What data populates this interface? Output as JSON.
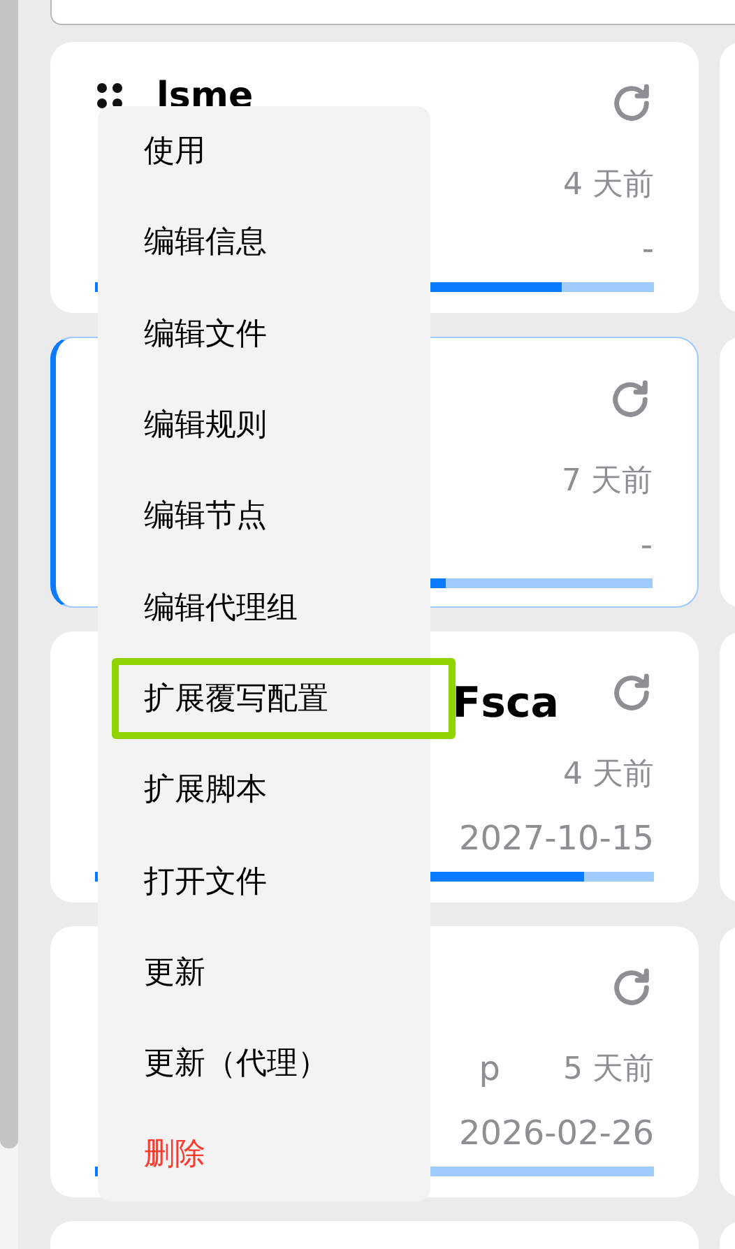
{
  "cards": [
    {
      "title": "lsme",
      "handle": true,
      "selected": false,
      "time": "4 天前",
      "expire": "-",
      "level": 0.835
    },
    {
      "handle": false,
      "selected": true,
      "time": "7 天前",
      "expire": "-",
      "level": 0.625
    },
    {
      "title": "Fsca",
      "handle": false,
      "selected": false,
      "time": "4 天前",
      "expire": "2027-10-15",
      "level": 0.875
    },
    {
      "handle": false,
      "selected": false,
      "subtitle": "p",
      "time": "5 天前",
      "expire": "2026-02-26",
      "level": 0.2
    }
  ],
  "menu": [
    {
      "label": "使用",
      "kind": "normal",
      "selected": false
    },
    {
      "label": "编辑信息",
      "kind": "normal",
      "selected": false
    },
    {
      "label": "编辑文件",
      "kind": "normal",
      "selected": false
    },
    {
      "label": "编辑规则",
      "kind": "normal",
      "selected": false
    },
    {
      "label": "编辑节点",
      "kind": "normal",
      "selected": false
    },
    {
      "label": "编辑代理组",
      "kind": "normal",
      "selected": false
    },
    {
      "label": "扩展覆写配置",
      "kind": "normal",
      "selected": true
    },
    {
      "label": "扩展脚本",
      "kind": "normal",
      "selected": false
    },
    {
      "label": "打开文件",
      "kind": "normal",
      "selected": false
    },
    {
      "label": "更新",
      "kind": "normal",
      "selected": false
    },
    {
      "label": "更新（代理）",
      "kind": "normal",
      "selected": false
    },
    {
      "label": "删除",
      "kind": "danger",
      "selected": false
    }
  ]
}
